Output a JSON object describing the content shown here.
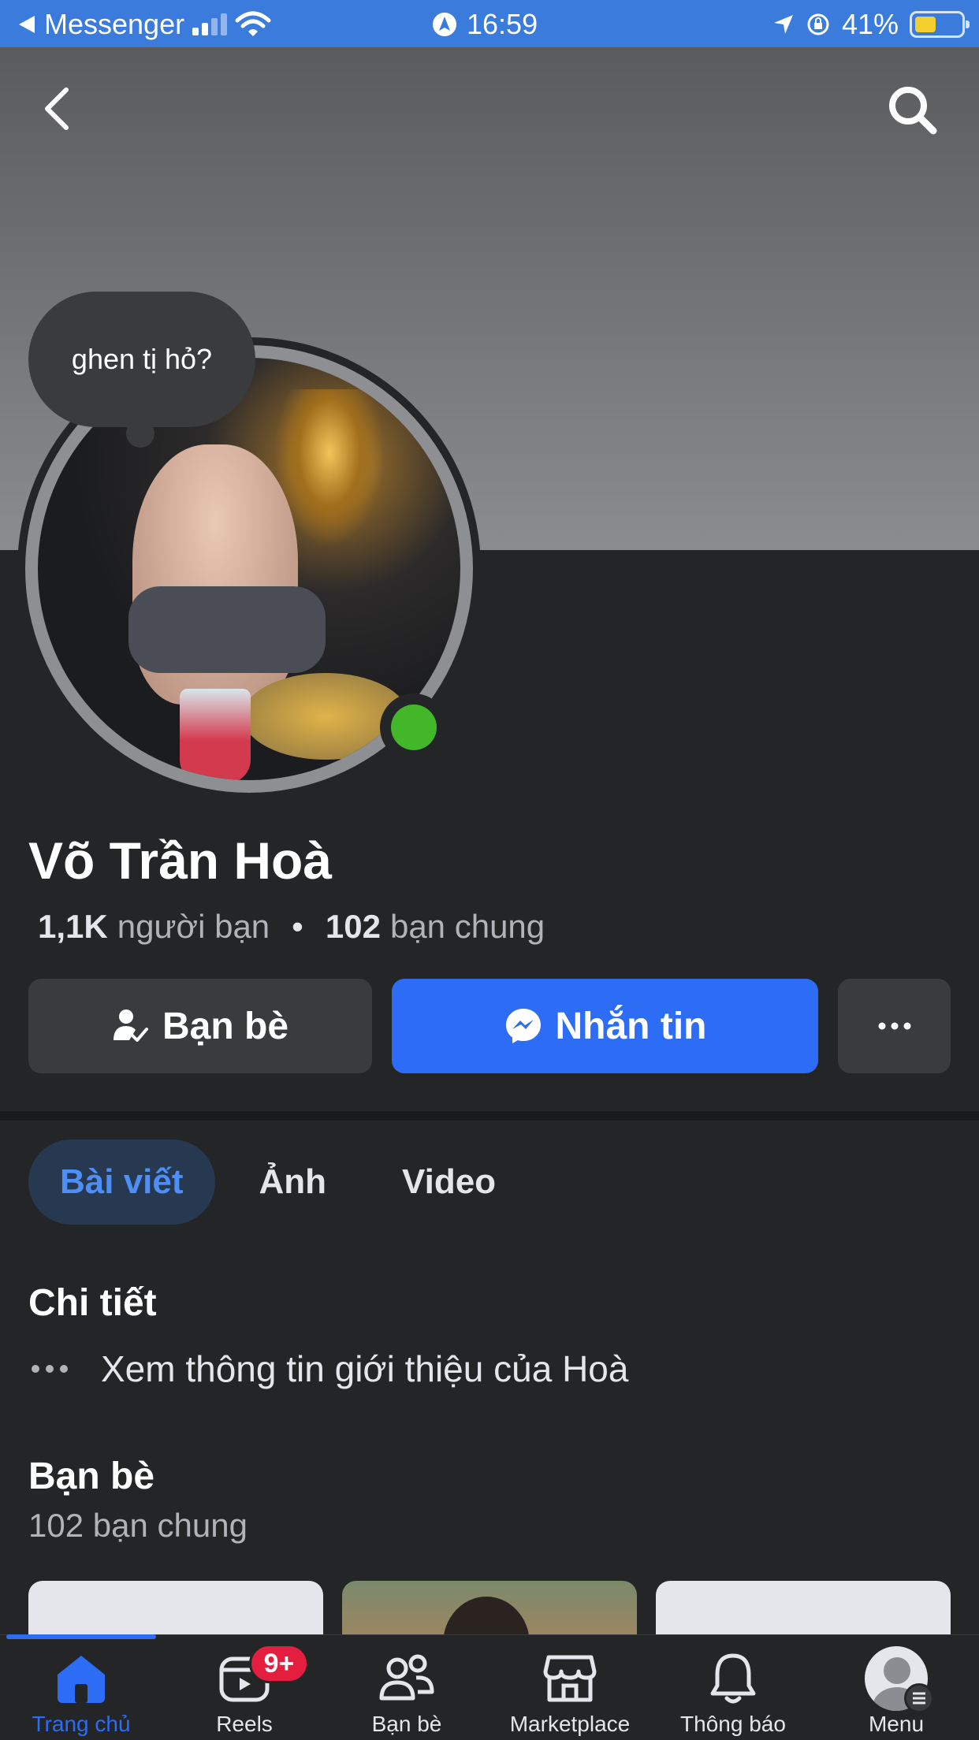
{
  "status_bar": {
    "back_app": "Messenger",
    "time": "16:59",
    "battery": "41%"
  },
  "profile": {
    "note": "ghen tị hỏ?",
    "name": "Võ Trần Hoà",
    "friends_count": "1,1K",
    "friends_label": "người bạn",
    "mutual_count": "102",
    "mutual_label": "bạn chung"
  },
  "actions": {
    "friends_label": "Bạn bè",
    "message_label": "Nhắn tin"
  },
  "tabs": [
    {
      "label": "Bài viết"
    },
    {
      "label": "Ảnh"
    },
    {
      "label": "Video"
    }
  ],
  "details": {
    "title": "Chi tiết",
    "intro": "Xem thông tin giới thiệu của Hoà"
  },
  "friends_section": {
    "title": "Bạn bè",
    "subtitle": "102 bạn chung"
  },
  "bottom_nav": {
    "items": [
      {
        "label": "Trang chủ"
      },
      {
        "label": "Reels",
        "badge": "9+"
      },
      {
        "label": "Bạn bè"
      },
      {
        "label": "Marketplace"
      },
      {
        "label": "Thông báo"
      },
      {
        "label": "Menu"
      }
    ]
  },
  "colors": {
    "accent": "#2d6cf5",
    "background": "#242526",
    "status_bar": "#3a7bdc",
    "online": "#42b72a",
    "badge": "#e41e3f"
  }
}
